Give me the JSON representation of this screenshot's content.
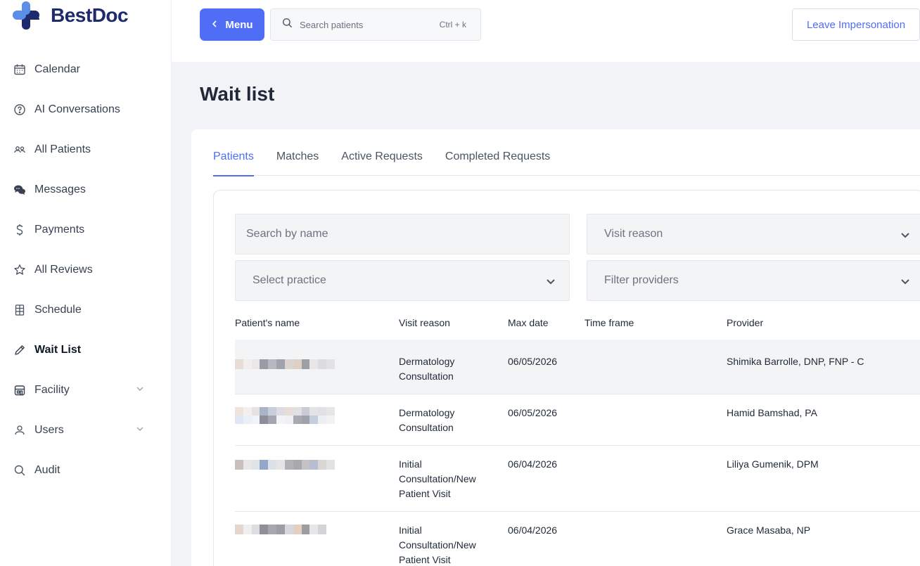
{
  "brand": {
    "name": "BestDoc"
  },
  "sidebar": {
    "items": [
      {
        "label": "Calendar",
        "icon": "calendar-icon"
      },
      {
        "label": "AI Conversations",
        "icon": "question-circle-icon"
      },
      {
        "label": "All Patients",
        "icon": "users-icon"
      },
      {
        "label": "Messages",
        "icon": "chat-bubbles-icon"
      },
      {
        "label": "Payments",
        "icon": "dollar-icon"
      },
      {
        "label": "All Reviews",
        "icon": "star-icon"
      },
      {
        "label": "Schedule",
        "icon": "schedule-icon"
      },
      {
        "label": "Wait List",
        "icon": "pencil-icon",
        "active": true
      },
      {
        "label": "Facility",
        "icon": "building-icon",
        "expandable": true
      },
      {
        "label": "Users",
        "icon": "user-icon",
        "expandable": true
      },
      {
        "label": "Audit",
        "icon": "search-icon"
      }
    ]
  },
  "topbar": {
    "menu_label": "Menu",
    "search_placeholder": "Search patients",
    "search_shortcut": "Ctrl + k",
    "leave_label": "Leave Impersonation"
  },
  "page": {
    "title": "Wait list"
  },
  "tabs": [
    {
      "label": "Patients",
      "active": true
    },
    {
      "label": "Matches"
    },
    {
      "label": "Active Requests"
    },
    {
      "label": "Completed Requests"
    }
  ],
  "filters": {
    "name_placeholder": "Search by name",
    "visit_reason_placeholder": "Visit reason",
    "practice_placeholder": "Select practice",
    "providers_placeholder": "Filter providers"
  },
  "table": {
    "headers": [
      "Patient's name",
      "Visit reason",
      "Max date",
      "Time frame",
      "Provider"
    ],
    "rows": [
      {
        "name": "",
        "visit_reason_l1": "Dermatology",
        "visit_reason_l2": "Consultation",
        "visit_reason_l3": "",
        "max_date": "06/05/2026",
        "time_frame": "",
        "provider": "Shimika Barrolle, DNP, FNP - C"
      },
      {
        "name": "",
        "visit_reason_l1": "Dermatology",
        "visit_reason_l2": "Consultation",
        "visit_reason_l3": "",
        "max_date": "06/05/2026",
        "time_frame": "",
        "provider": "Hamid Bamshad, PA"
      },
      {
        "name": "",
        "visit_reason_l1": "Initial",
        "visit_reason_l2": "Consultation/New",
        "visit_reason_l3": "Patient Visit",
        "max_date": "06/04/2026",
        "time_frame": "",
        "provider": "Liliya Gumenik, DPM"
      },
      {
        "name": "",
        "visit_reason_l1": "Initial",
        "visit_reason_l2": "Consultation/New",
        "visit_reason_l3": "Patient Visit",
        "max_date": "06/04/2026",
        "time_frame": "",
        "provider": "Grace Masaba, NP"
      }
    ]
  },
  "colors": {
    "accent": "#4f6df5",
    "brand_dark": "#1e2a6e",
    "brand_light": "#5b8ee6"
  }
}
